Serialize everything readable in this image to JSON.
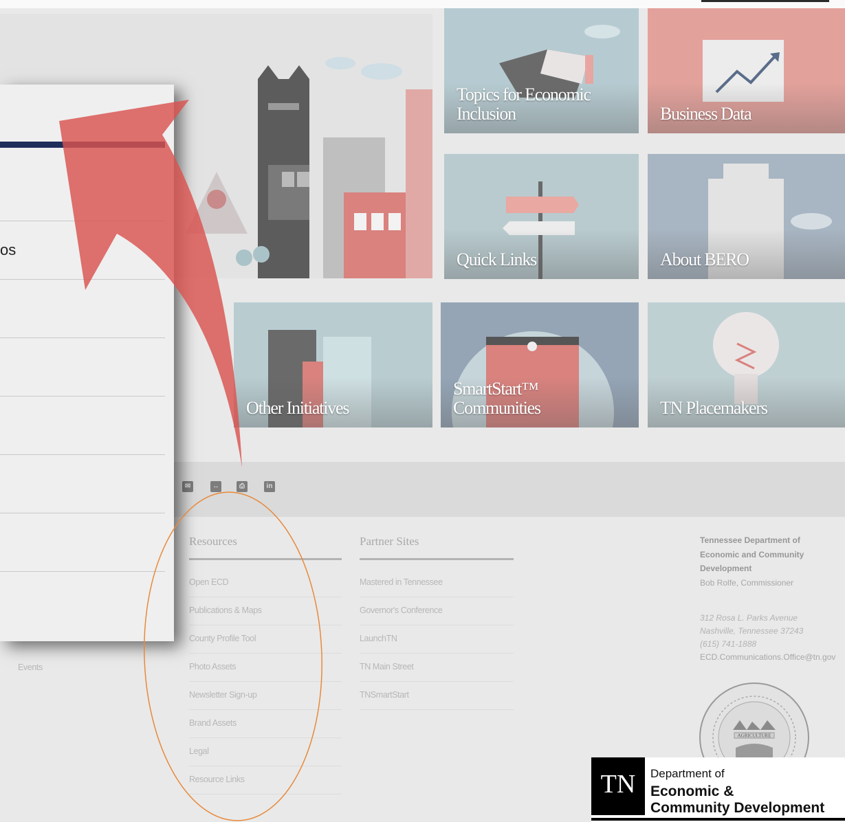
{
  "tiles": {
    "topics": "Topics for Economic Inclusion",
    "business_data": "Business Data",
    "quick_links": "Quick Links",
    "about_bero": "About BERO",
    "other_initiatives": "Other Initiatives",
    "smartstart": "SmartStart™ Communities",
    "placemakers": "TN Placemakers"
  },
  "panel": {
    "partial_text": "os"
  },
  "footer": {
    "left_partial": "Events",
    "resources": {
      "heading": "Resources",
      "links": [
        "Open ECD",
        "Publications & Maps",
        "County Profile Tool",
        "Photo Assets",
        "Newsletter Sign-up",
        "Brand Assets",
        "Legal",
        "Resource Links"
      ]
    },
    "partners": {
      "heading": "Partner Sites",
      "links": [
        "Mastered in Tennessee",
        "Governor's Conference",
        "LaunchTN",
        "TN Main Street",
        "TNSmartStart"
      ]
    },
    "contact": {
      "org_line1": "Tennessee Department of",
      "org_line2": "Economic and Community",
      "org_line3": "Development",
      "commissioner": "Bob Rolfe, Commissioner",
      "street": "312 Rosa L. Parks Avenue",
      "city": "Nashville, Tennessee 37243",
      "phone": "(615) 741-1888",
      "email": "ECD.Communications.Office@tn.gov"
    },
    "seal_text": "AGRICULTURE"
  },
  "logo": {
    "mark": "TN",
    "line1": "Department of",
    "line2": "Economic &",
    "line3": "Community Development"
  },
  "colors": {
    "arrow": "#d9534f",
    "circle_annotation": "#e8893a",
    "panel_bar": "#1f2d5a",
    "tile_pink": "#e9a8a2",
    "tile_blue_gray": "#b9c7cf"
  }
}
